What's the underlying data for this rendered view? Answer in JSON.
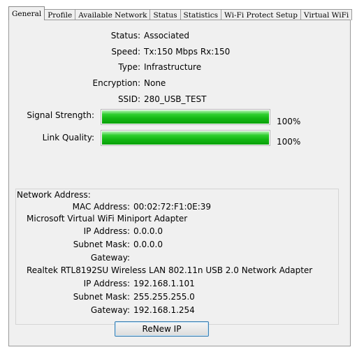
{
  "tabs": [
    {
      "label": "General",
      "active": true
    },
    {
      "label": "Profile",
      "active": false
    },
    {
      "label": "Available Network",
      "active": false
    },
    {
      "label": "Status",
      "active": false
    },
    {
      "label": "Statistics",
      "active": false
    },
    {
      "label": "Wi-Fi Protect Setup",
      "active": false
    },
    {
      "label": "Virtual WiFi",
      "active": false
    }
  ],
  "general": {
    "status_label": "Status:",
    "status_value": "Associated",
    "speed_label": "Speed:",
    "speed_value": "Tx:150 Mbps Rx:150",
    "type_label": "Type:",
    "type_value": "Infrastructure",
    "encryption_label": "Encryption:",
    "encryption_value": "None",
    "ssid_label": "SSID:",
    "ssid_value": "280_USB_TEST",
    "signal_label": "Signal Strength:",
    "signal_percent": "100%",
    "signal_fraction": 1.0,
    "link_label": "Link Quality:",
    "link_percent": "100%",
    "link_fraction": 1.0
  },
  "network": {
    "group_label": "Network Address:",
    "mac_label": "MAC Address:",
    "mac_value": "00:02:72:F1:0E:39",
    "adapter1_name": "Microsoft Virtual WiFi Miniport Adapter",
    "adapter1_ip_label": "IP Address:",
    "adapter1_ip": "0.0.0.0",
    "adapter1_mask_label": "Subnet Mask:",
    "adapter1_mask": "0.0.0.0",
    "adapter1_gw_label": "Gateway:",
    "adapter1_gw": "",
    "adapter2_name": "Realtek RTL8192SU Wireless LAN 802.11n USB 2.0 Network Adapter",
    "adapter2_ip_label": "IP Address:",
    "adapter2_ip": "192.168.1.101",
    "adapter2_mask_label": "Subnet Mask:",
    "adapter2_mask": "255.255.255.0",
    "adapter2_gw_label": "Gateway:",
    "adapter2_gw": "192.168.1.254"
  },
  "renew_button": "ReNew IP",
  "colors": {
    "bar_fill": "#14b814",
    "panel_bg": "#f0f0f0",
    "button_border": "#3c7fb1"
  }
}
